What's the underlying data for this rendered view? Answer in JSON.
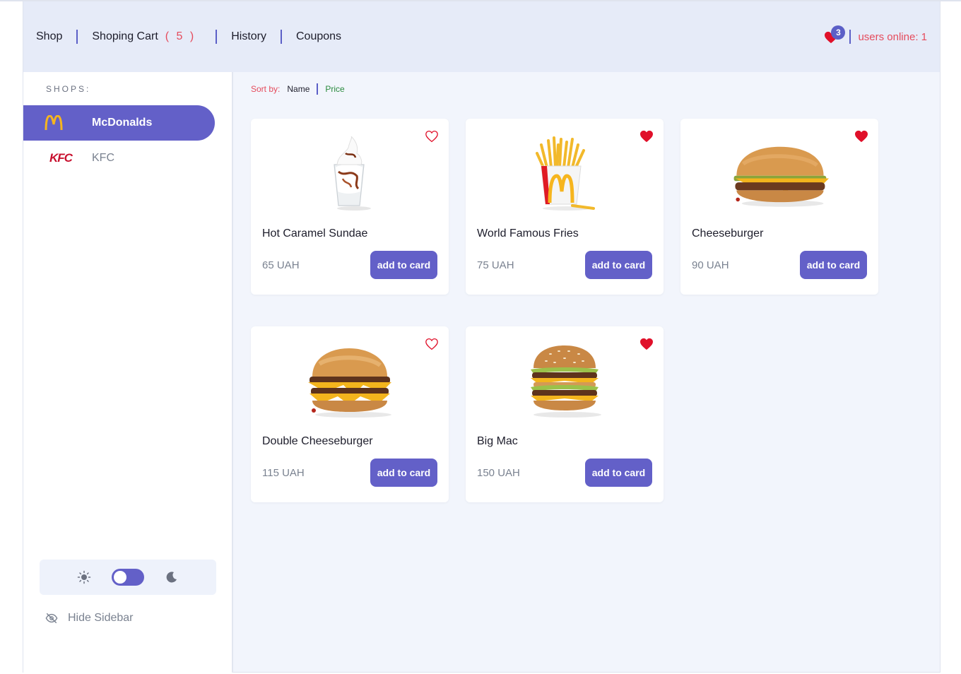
{
  "header": {
    "nav": {
      "shop": "Shop",
      "cart": "Shoping Cart",
      "cart_count": "( 5 )",
      "history": "History",
      "coupons": "Coupons"
    },
    "favorites_badge": "3",
    "users_online": "users online: 1",
    "accent_color": "#6360c8",
    "alert_color": "#e54b5c"
  },
  "sidebar": {
    "title": "SHOPS:",
    "shops": [
      {
        "label": "McDonalds",
        "icon": "mcdonalds-logo-icon",
        "active": true
      },
      {
        "label": "KFC",
        "icon": "kfc-logo-icon",
        "active": false
      }
    ],
    "kfc_logo_text": "KFC",
    "hide_sidebar": "Hide Sidebar"
  },
  "sort": {
    "label": "Sort by:",
    "name": "Name",
    "price": "Price"
  },
  "products": [
    {
      "name": "Hot Caramel Sundae",
      "price": "65 UAH",
      "button": "add to card",
      "favorite": false,
      "icon": "sundae-image"
    },
    {
      "name": "World Famous Fries",
      "price": "75 UAH",
      "button": "add to card",
      "favorite": true,
      "icon": "fries-image"
    },
    {
      "name": "Cheeseburger",
      "price": "90 UAH",
      "button": "add to card",
      "favorite": true,
      "icon": "cheeseburger-image"
    },
    {
      "name": "Double Cheeseburger",
      "price": "115 UAH",
      "button": "add to card",
      "favorite": false,
      "icon": "double-cheeseburger-image"
    },
    {
      "name": "Big Mac",
      "price": "150 UAH",
      "button": "add to card",
      "favorite": true,
      "icon": "big-mac-image"
    }
  ]
}
